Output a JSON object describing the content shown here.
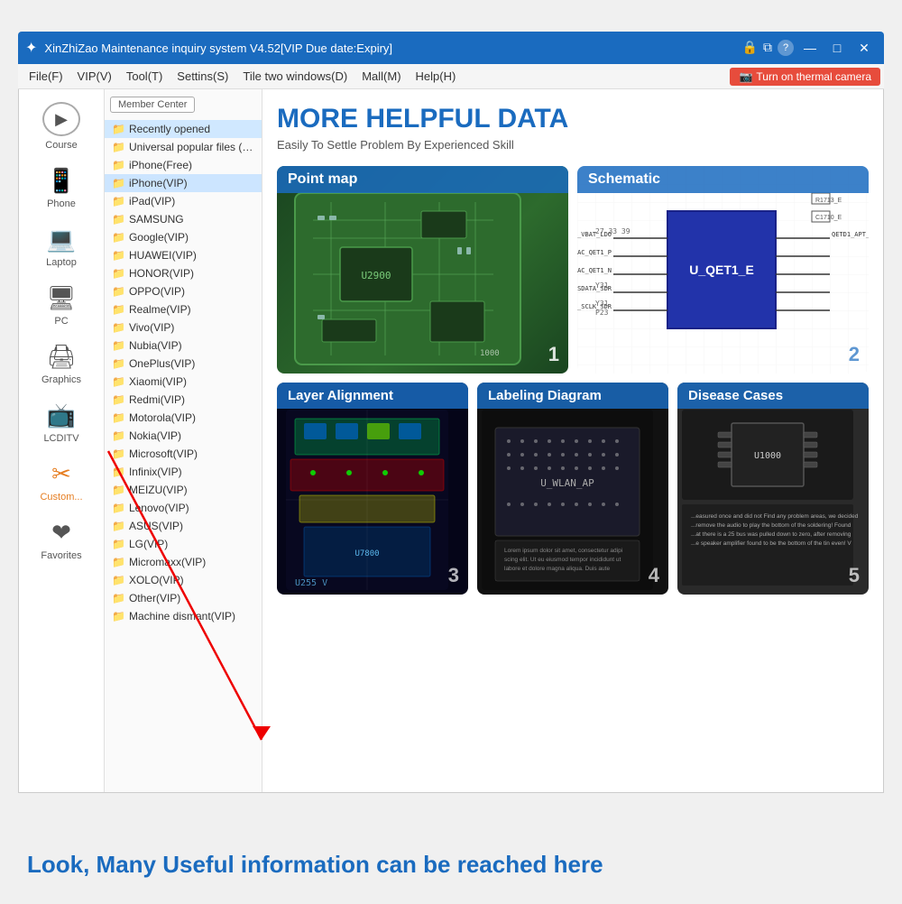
{
  "titlebar": {
    "title": "XinZhiZao Maintenance inquiry system V4.52[VIP Due date:Expiry]",
    "icon": "✦",
    "controls": {
      "lock": "🔒",
      "copy": "⧉",
      "help": "?",
      "minimize": "—",
      "maximize": "□",
      "close": "✕"
    }
  },
  "menubar": {
    "items": [
      "File(F)",
      "VIP(V)",
      "Tool(T)",
      "Settins(S)",
      "Tile two windows(D)",
      "Mall(M)",
      "Help(H)"
    ],
    "thermal_btn": "Turn on thermal camera"
  },
  "sidebar": {
    "items": [
      {
        "id": "course",
        "label": "Course",
        "icon": "▶"
      },
      {
        "id": "phone",
        "label": "Phone",
        "icon": "📱"
      },
      {
        "id": "laptop",
        "label": "Laptop",
        "icon": "💻"
      },
      {
        "id": "pc",
        "label": "PC",
        "icon": "🖥"
      },
      {
        "id": "graphics",
        "label": "Graphics",
        "icon": "🖨"
      },
      {
        "id": "lcditv",
        "label": "LCDITV",
        "icon": "📺"
      },
      {
        "id": "custom",
        "label": "Custom...",
        "icon": "✂"
      },
      {
        "id": "favorites",
        "label": "Favorites",
        "icon": "❤"
      }
    ]
  },
  "filetree": {
    "member_btn": "Member Center",
    "items": [
      "Recently opened",
      "Universal popular files (free",
      "iPhone(Free)",
      "iPhone(VIP)",
      "iPad(VIP)",
      "SAMSUNG",
      "Google(VIP)",
      "HUAWEI(VIP)",
      "HONOR(VIP)",
      "OPPO(VIP)",
      "Realme(VIP)",
      "Vivo(VIP)",
      "Nubia(VIP)",
      "OnePlus(VIP)",
      "Xiaomi(VIP)",
      "Redmi(VIP)",
      "Motorola(VIP)",
      "Nokia(VIP)",
      "Microsoft(VIP)",
      "Infinix(VIP)",
      "MEIZU(VIP)",
      "Lenovo(VIP)",
      "ASUS(VIP)",
      "LG(VIP)",
      "Micromaxx(VIP)",
      "XOLO(VIP)",
      "Other(VIP)",
      "Machine dismant(VIP)"
    ]
  },
  "content": {
    "hero_title": "MORE HELPFUL DATA",
    "hero_subtitle": "Easily To Settle Problem By Experienced Skill",
    "cards": [
      {
        "id": "point-map",
        "title": "Point map",
        "number": "1",
        "type": "pcb"
      },
      {
        "id": "schematic",
        "title": "Schematic",
        "number": "2",
        "type": "schematic"
      },
      {
        "id": "layer-alignment",
        "title": "Layer Alignment",
        "number": "3",
        "type": "layer"
      },
      {
        "id": "labeling-diagram",
        "title": "Labeling Diagram",
        "number": "4",
        "type": "label"
      },
      {
        "id": "disease-cases",
        "title": "Disease Cases",
        "number": "5",
        "type": "disease"
      }
    ]
  },
  "bottom_text": "Look, Many Useful information can be reached here",
  "colors": {
    "primary": "#1a6bbf",
    "accent": "#e67e22",
    "danger": "#e74c3c",
    "folder": "#f5a623"
  }
}
